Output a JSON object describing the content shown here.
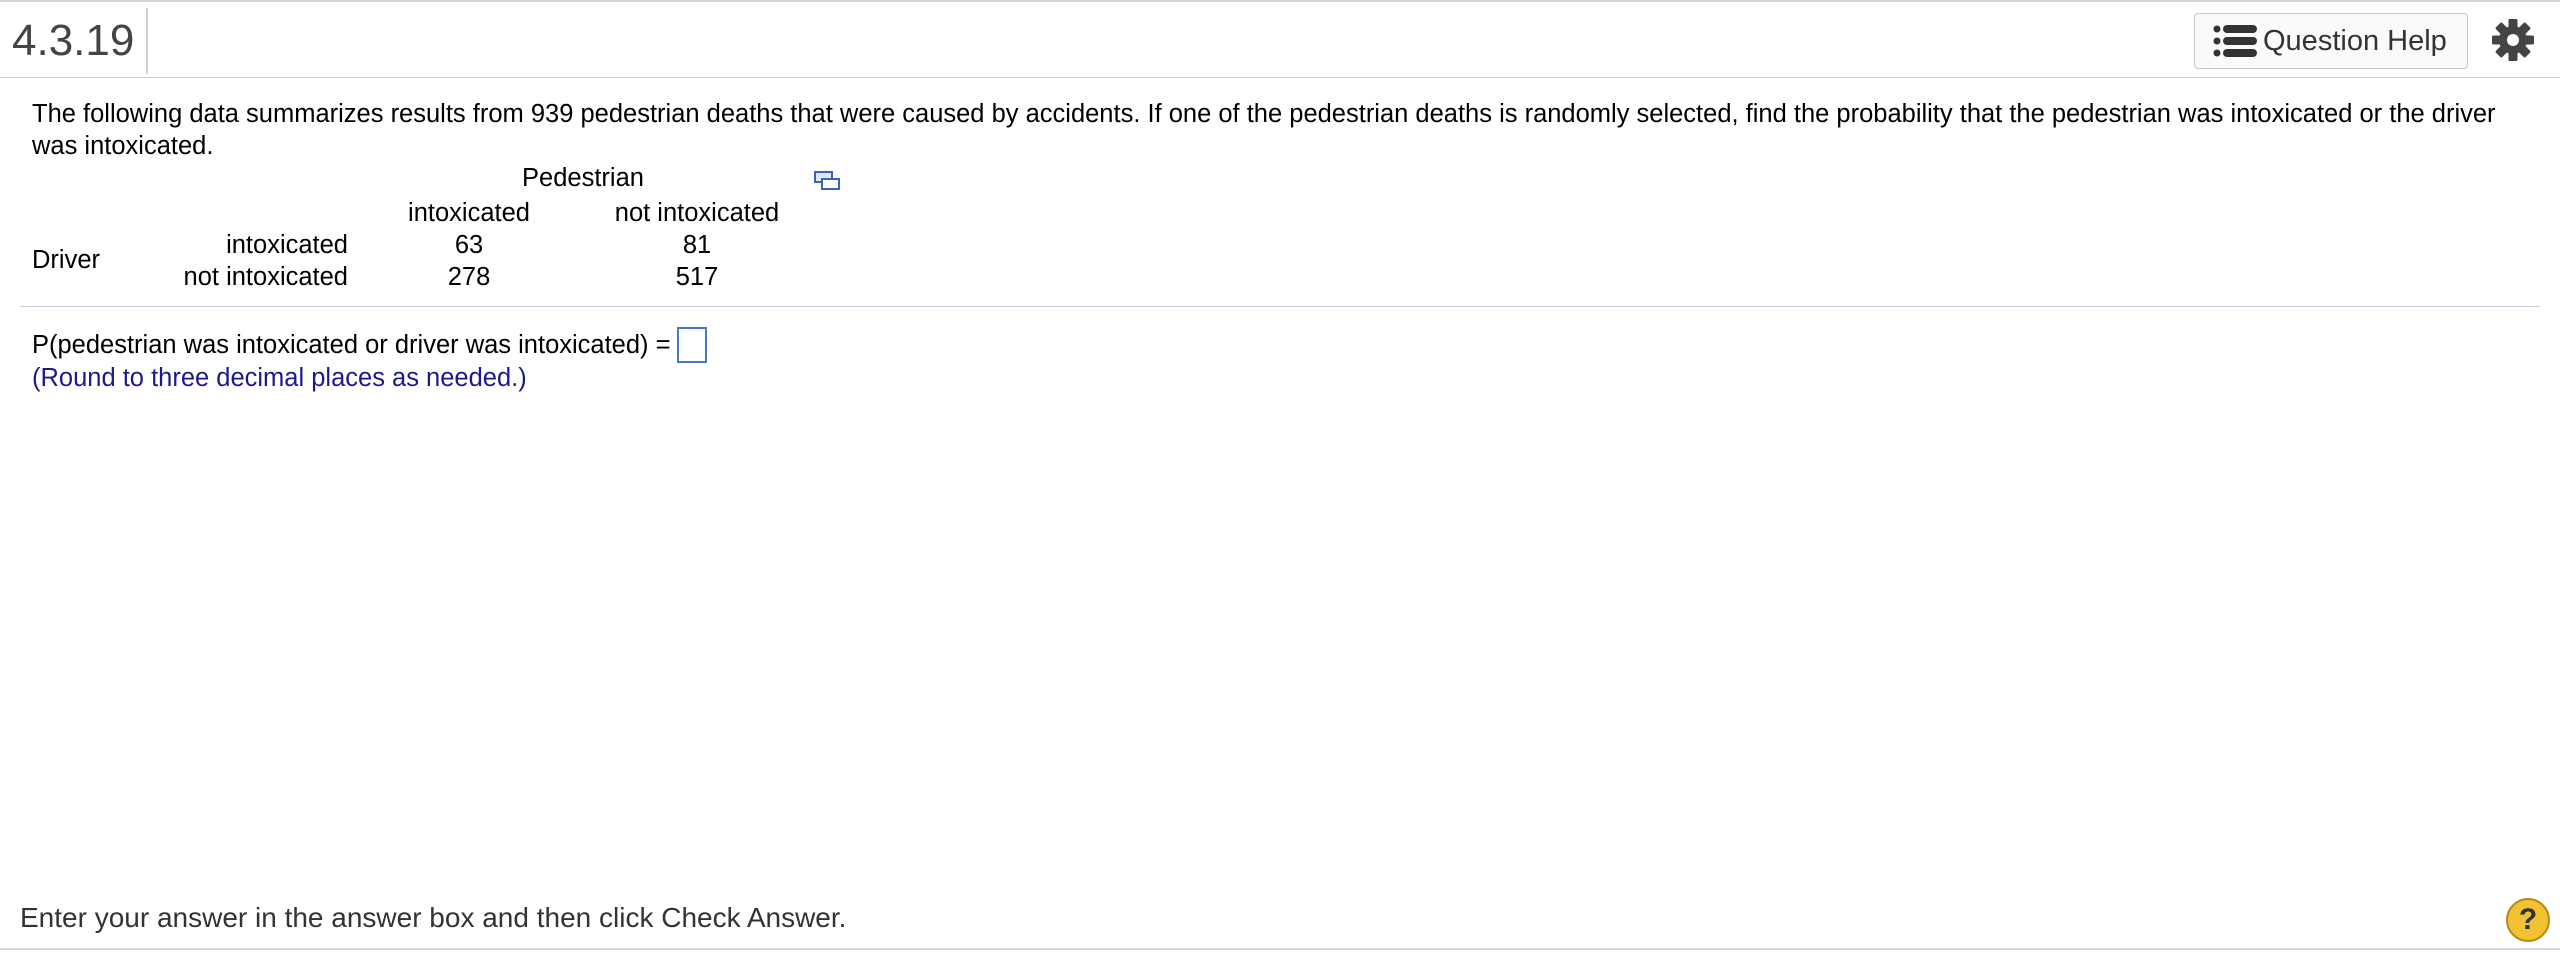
{
  "header": {
    "question_number": "4.3.19",
    "help_label": "Question Help"
  },
  "question": {
    "text": "The following data summarizes results from 939 pedestrian deaths that were caused by accidents. If one of the pedestrian deaths is randomly selected, find the probability that the pedestrian was intoxicated or the driver was intoxicated."
  },
  "table": {
    "column_group": "Pedestrian",
    "columns": [
      "intoxicated",
      "not intoxicated"
    ],
    "row_group": "Driver",
    "rows": [
      {
        "label": "intoxicated",
        "values": [
          "63",
          "81"
        ]
      },
      {
        "label": "not intoxicated",
        "values": [
          "278",
          "517"
        ]
      }
    ]
  },
  "answer": {
    "prompt": "P(pedestrian was intoxicated or driver was intoxicated) =",
    "value": "",
    "note": "(Round to three decimal places as needed.)"
  },
  "footer": {
    "instruction": "Enter your answer in the answer box and then click Check Answer.",
    "help_symbol": "?"
  },
  "colors": {
    "answer_box_border": "#4a78c8",
    "note_text": "#1a1a8c",
    "help_circle": "#f3c234"
  }
}
